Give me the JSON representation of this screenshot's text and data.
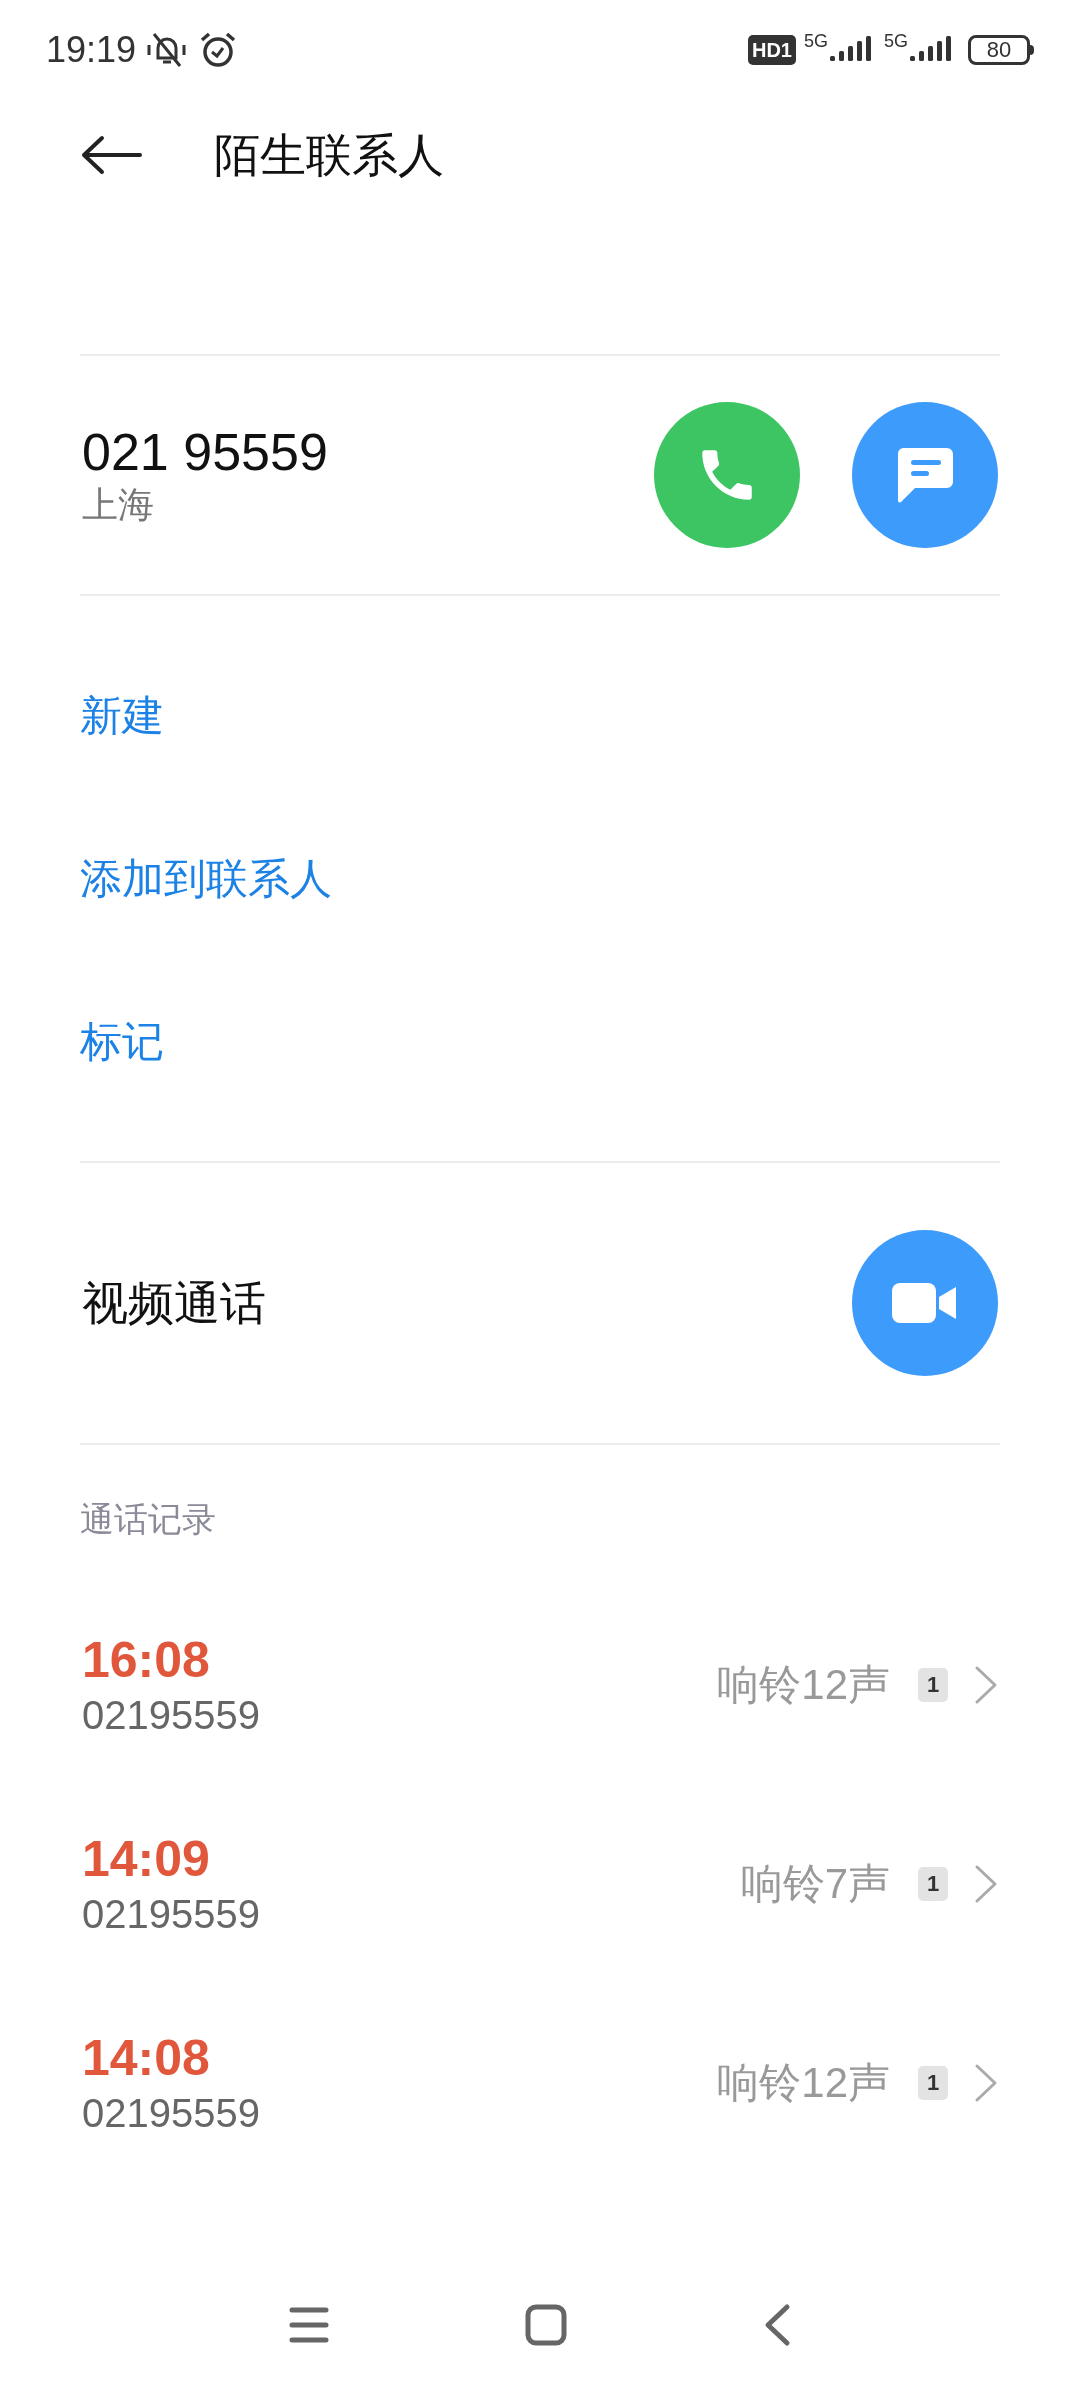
{
  "status_bar": {
    "time": "19:19",
    "hd_label": "HD1",
    "sim_1_network": "5G",
    "sim_2_network": "5G",
    "battery": "80"
  },
  "header": {
    "title": "陌生联系人"
  },
  "contact": {
    "number": "021 95559",
    "location": "上海"
  },
  "actions": [
    {
      "label": "新建"
    },
    {
      "label": "添加到联系人"
    },
    {
      "label": "标记"
    }
  ],
  "video_call": {
    "label": "视频通话"
  },
  "call_log": {
    "heading": "通话记录",
    "entries": [
      {
        "time": "16:08",
        "number": "02195559",
        "detail": "响铃12声",
        "sim": "1"
      },
      {
        "time": "14:09",
        "number": "02195559",
        "detail": "响铃7声",
        "sim": "1"
      },
      {
        "time": "14:08",
        "number": "02195559",
        "detail": "响铃12声",
        "sim": "1"
      }
    ]
  }
}
